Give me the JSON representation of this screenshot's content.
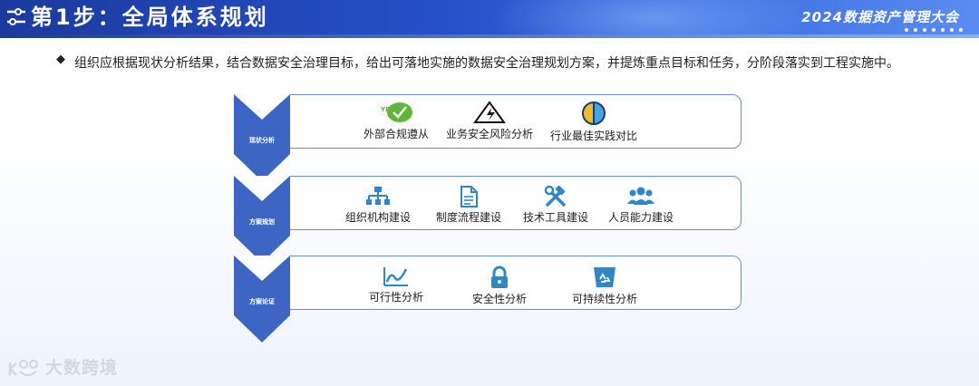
{
  "header": {
    "title": "第1步：全局体系规划",
    "event": "2024数据资产管理大会"
  },
  "intro": {
    "text": "组织应根据现状分析结果，结合数据安全治理目标，给出可落地实施的数据安全治理规划方案，并提炼重点目标和任务，分阶段落实到工程实施中。"
  },
  "rows": [
    {
      "stage": "现状分析",
      "items": [
        {
          "icon": "yes-badge-icon",
          "label": "外部合规遵从",
          "badge_text": "YES"
        },
        {
          "icon": "warning-triangle-icon",
          "label": "业务安全风险分析"
        },
        {
          "icon": "half-circle-compare-icon",
          "label": "行业最佳实践对比"
        }
      ]
    },
    {
      "stage": "方案规划",
      "items": [
        {
          "icon": "org-chart-icon",
          "label": "组织机构建设"
        },
        {
          "icon": "document-icon",
          "label": "制度流程建设"
        },
        {
          "icon": "tools-icon",
          "label": "技术工具建设"
        },
        {
          "icon": "people-icon",
          "label": "人员能力建设"
        }
      ]
    },
    {
      "stage": "方案论证",
      "items": [
        {
          "icon": "trend-line-icon",
          "label": "可行性分析"
        },
        {
          "icon": "lock-icon",
          "label": "安全性分析"
        },
        {
          "icon": "recycle-bin-icon",
          "label": "可持续性分析"
        }
      ]
    }
  ],
  "watermark": {
    "text": "大数跨境"
  },
  "colors": {
    "banner": "#2650c8",
    "chevron": "#3d66c4",
    "icon": "#2f87c8",
    "box_border": "#6a8ad8"
  }
}
